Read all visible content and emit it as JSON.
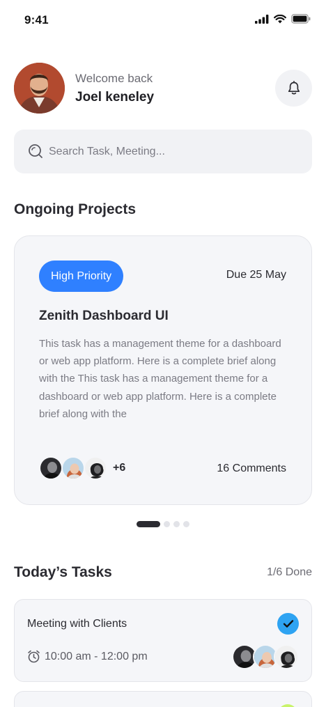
{
  "status_bar": {
    "time": "9:41"
  },
  "header": {
    "welcome": "Welcome back",
    "name": "Joel keneley"
  },
  "search": {
    "placeholder": "Search Task, Meeting..."
  },
  "ongoing": {
    "title": "Ongoing Projects",
    "card": {
      "badge": "High Priority",
      "due": "Due 25 May",
      "title": "Zenith Dashboard UI",
      "description": "This task has a management theme for a dashboard or web app platform. Here is a complete brief along with the This task has a management theme for a dashboard or web app platform. Here is a complete brief along with the",
      "members_extra": "+6",
      "comments": "16 Comments"
    },
    "pager": {
      "total": 4,
      "active": 1
    }
  },
  "tasks": {
    "title": "Today’s Tasks",
    "done": "1/6 Done",
    "items": [
      {
        "title": "Meeting with Clients",
        "time": "10:00 am - 12:00 pm",
        "completed": true
      }
    ]
  },
  "colors": {
    "accent": "#2f80ff",
    "check": "#2ea3f2",
    "surface": "#f5f6f9"
  }
}
